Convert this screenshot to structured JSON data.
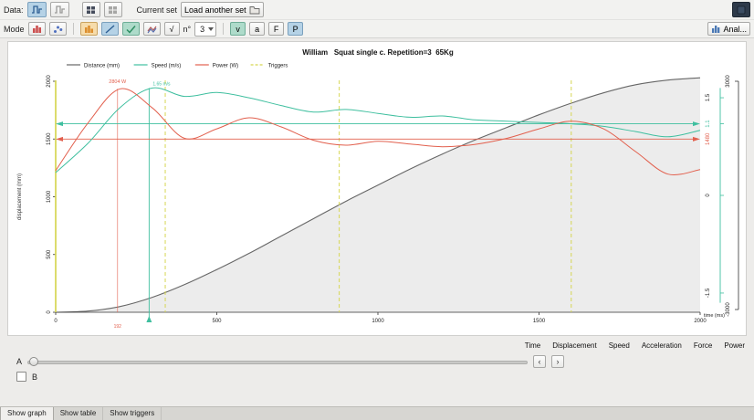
{
  "toolbar1": {
    "data_label": "Data:",
    "current_set_label": "Current set",
    "load_button_label": "Load another set"
  },
  "toolbar2": {
    "mode_label": "Mode",
    "sqrt_label": "√",
    "n_label": "n°",
    "n_value": "3",
    "speed_button": "v",
    "accel_button": "a",
    "force_button": "F",
    "power_button": "P",
    "analyze_button": "Anal..."
  },
  "bottom": {
    "columns": [
      "Time",
      "Displacement",
      "Speed",
      "Acceleration",
      "Force",
      "Power"
    ],
    "a_label": "A",
    "b_label": "B",
    "prev_button": "‹",
    "next_button": "›"
  },
  "tabs": [
    {
      "label": "Show graph"
    },
    {
      "label": "Show table"
    },
    {
      "label": "Show triggers"
    }
  ],
  "chart_data": {
    "type": "line",
    "title": "William   Squat single c. Repetition=3  65Kg",
    "x": [
      0,
      100,
      200,
      300,
      400,
      500,
      600,
      700,
      800,
      900,
      1000,
      1100,
      1200,
      1300,
      1400,
      1500,
      1600,
      1700,
      1800,
      1900,
      2000
    ],
    "x_axis": {
      "label": "time (ms)",
      "min": 0,
      "max": 2000,
      "ticks": [
        0,
        500,
        1000,
        1500,
        2000
      ]
    },
    "disp_axis": {
      "label": "displacement (mm)",
      "min": 0,
      "max": 2000,
      "ticks": [
        0,
        500,
        1000,
        1500,
        2000
      ]
    },
    "speed_axis": {
      "ticks": [
        1.5,
        0,
        -1.5
      ],
      "mean": 1.1,
      "color": "#3fbf9f"
    },
    "power_axis": {
      "ticks": [
        3000,
        -3000
      ],
      "zero": 0,
      "mean": 1480,
      "color": "#e2604e"
    },
    "series": {
      "displacement": {
        "label": "Distance (mm)",
        "color": "#666666",
        "fill": "#ececec",
        "values": [
          0,
          10,
          50,
          130,
          240,
          370,
          510,
          660,
          810,
          960,
          1100,
          1240,
          1370,
          1490,
          1600,
          1710,
          1810,
          1900,
          1970,
          2010,
          2030
        ]
      },
      "speed": {
        "label": "Speed (m/s)",
        "color": "#3fbf9f",
        "values": [
          0.35,
          0.8,
          1.35,
          1.65,
          1.52,
          1.58,
          1.5,
          1.38,
          1.28,
          1.32,
          1.26,
          1.2,
          1.22,
          1.16,
          1.14,
          1.12,
          1.1,
          1.06,
          0.98,
          0.9,
          1.0
        ]
      },
      "power": {
        "label": "Power (W)",
        "color": "#e2604e",
        "values": [
          650,
          1900,
          2800,
          2300,
          1500,
          1750,
          2040,
          1800,
          1450,
          1320,
          1420,
          1350,
          1280,
          1340,
          1500,
          1750,
          1950,
          1750,
          1150,
          560,
          680
        ]
      }
    },
    "triggers": {
      "label": "Triggers",
      "color": "#d6d652",
      "x": [
        0,
        340,
        880,
        1600
      ]
    },
    "annotations": {
      "power_peak": {
        "x": 192,
        "y": 2804,
        "label": "2804 W"
      },
      "speed_peak": {
        "x": 290,
        "y": 1.65,
        "label": "1.65 m/s"
      },
      "time_marker": {
        "x": 192,
        "label": "192"
      }
    },
    "legend_position": "top-left",
    "grid": false
  }
}
